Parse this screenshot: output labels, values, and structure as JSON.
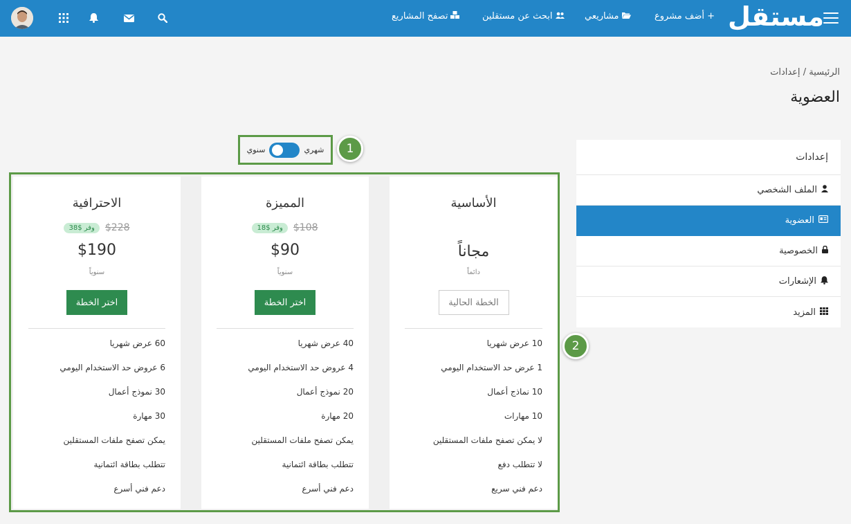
{
  "header": {
    "logo": "مستقل",
    "nav": {
      "add_project": "+ أضف مشروع",
      "my_projects": "مشاريعي",
      "find_freelancers": "ابحث عن مستقلين",
      "browse_projects": "تصفح المشاريع"
    },
    "brand_color": "#2386c8"
  },
  "breadcrumb": {
    "home": "الرئيسية",
    "separator": "/",
    "current": "إعدادات"
  },
  "page_title": "العضوية",
  "sidebar": {
    "header": "إعدادات",
    "items": [
      {
        "label": "الملف الشخصي",
        "icon": "user-icon"
      },
      {
        "label": "العضوية",
        "icon": "id-card-icon",
        "active": true
      },
      {
        "label": "الخصوصية",
        "icon": "lock-icon"
      },
      {
        "label": "الإشعارات",
        "icon": "bell-icon"
      },
      {
        "label": "المزيد",
        "icon": "grid-icon"
      }
    ]
  },
  "billing_toggle": {
    "monthly": "شهري",
    "yearly": "سنوي"
  },
  "callouts": {
    "one": "1",
    "two": "2"
  },
  "plans": [
    {
      "name": "الأساسية",
      "price": "مجاناً",
      "period": "دائماً",
      "button": "الخطة الحالية",
      "features": [
        "10 عرض شهريا",
        "1 عرض حد الاستخدام اليومي",
        "10 نماذج أعمال",
        "10 مهارات",
        "لا يمكن تصفح ملفات المستقلين",
        "لا تتطلب دفع",
        "دعم فني سريع"
      ]
    },
    {
      "name": "المميزة",
      "old_price": "$108",
      "save": "وفر $18",
      "price": "$90",
      "period": "سنوياً",
      "button": "اختر الخطة",
      "features": [
        "40 عرض شهريا",
        "4 عروض حد الاستخدام اليومي",
        "20 نموذج أعمال",
        "20 مهارة",
        "يمكن تصفح ملفات المستقلين",
        "تتطلب بطاقة ائتمانية",
        "دعم فني أسرع"
      ]
    },
    {
      "name": "الاحترافية",
      "old_price": "$228",
      "save": "وفر $38",
      "price": "$190",
      "period": "سنوياً",
      "button": "اختر الخطة",
      "features": [
        "60 عرض شهريا",
        "6 عروض حد الاستخدام اليومي",
        "30 نموذج أعمال",
        "30 مهارة",
        "يمكن تصفح ملفات المستقلين",
        "تتطلب بطاقة ائتمانية",
        "دعم فني أسرع"
      ]
    }
  ]
}
